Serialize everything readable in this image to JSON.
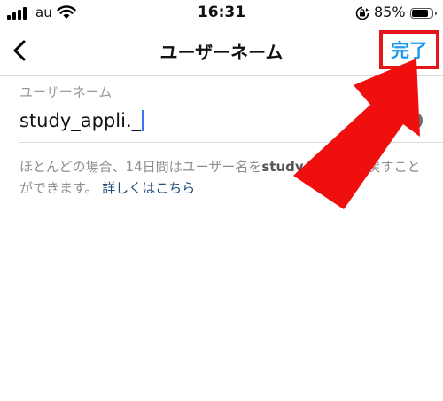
{
  "status_bar": {
    "carrier": "au",
    "time": "16:31",
    "battery_percent": "85%",
    "battery_level": 0.85
  },
  "nav": {
    "title": "ユーザーネーム",
    "done_label": "完了"
  },
  "field": {
    "label": "ユーザーネーム",
    "value": "study_appli._"
  },
  "help": {
    "text_prefix": "ほとんどの場合、14日間はユーザー名を",
    "username_bold": "study_appli_",
    "text_suffix": "に戻すことができます。",
    "link": "詳しくはこちら"
  },
  "colors": {
    "accent_blue": "#1a9bf0",
    "highlight_red": "#e5161a",
    "link_blue": "#1f4d7a"
  },
  "icons": [
    "signal-icon",
    "wifi-icon",
    "orientation-lock-icon",
    "battery-icon",
    "back-chevron-icon",
    "clear-icon"
  ]
}
